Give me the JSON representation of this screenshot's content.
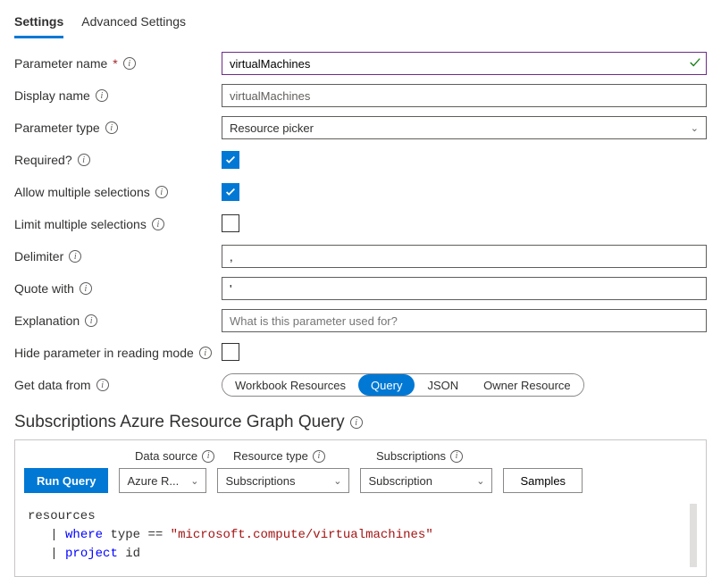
{
  "tabs": {
    "settings": "Settings",
    "advanced": "Advanced Settings"
  },
  "labels": {
    "paramName": "Parameter name",
    "displayName": "Display name",
    "paramType": "Parameter type",
    "required": "Required?",
    "allowMulti": "Allow multiple selections",
    "limitMulti": "Limit multiple selections",
    "delimiter": "Delimiter",
    "quoteWith": "Quote with",
    "explanation": "Explanation",
    "hideParam": "Hide parameter in reading mode",
    "getData": "Get data from"
  },
  "values": {
    "paramName": "virtualMachines",
    "displayName": "virtualMachines",
    "paramType": "Resource picker",
    "delimiter": ",",
    "quoteWith": "'",
    "explanationPlaceholder": "What is this parameter used for?"
  },
  "pills": {
    "workbook": "Workbook Resources",
    "query": "Query",
    "json": "JSON",
    "owner": "Owner Resource"
  },
  "sectionTitle": "Subscriptions Azure Resource Graph Query",
  "query": {
    "dataSourceLbl": "Data source",
    "resourceTypeLbl": "Resource type",
    "subscriptionsLbl": "Subscriptions",
    "run": "Run Query",
    "dataSource": "Azure R...",
    "resourceType": "Subscriptions",
    "subscriptions": "Subscription",
    "samples": "Samples"
  }
}
